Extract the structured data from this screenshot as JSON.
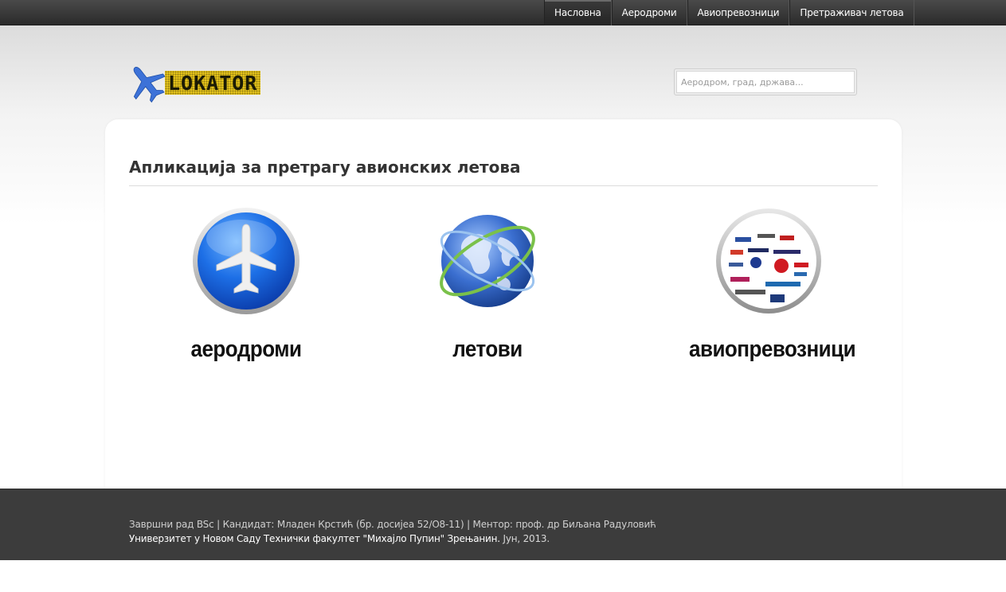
{
  "nav": {
    "items": [
      {
        "label": "Насловна",
        "active": true
      },
      {
        "label": "Аеродроми",
        "active": false
      },
      {
        "label": "Авиопревозници",
        "active": false
      },
      {
        "label": "Претраживач летова",
        "active": false
      }
    ]
  },
  "logo": {
    "text": "LOKATOR",
    "icon": "airplane-icon"
  },
  "search": {
    "placeholder": "Аеродром, град, држава..."
  },
  "main": {
    "title": "Апликација за претрагу авионских летова",
    "features": [
      {
        "label": "аеродроми",
        "icon": "airplane-circle-icon"
      },
      {
        "label": "летови",
        "icon": "globe-icon"
      },
      {
        "label": "авиопревозници",
        "icon": "airlines-logos-icon"
      }
    ]
  },
  "footer": {
    "line1": "Завршни рад BSc  |  Кандидат: Младен Крстић (бр. досијеа 52/О8-11)  |  Ментор: проф. др Биљана Радуловић",
    "line2_bold": "Универзитет у Новом Саду Технички факултет \"Михајло Пупин\" Зрењанин.",
    "line2_rest": " Јун, 2013."
  },
  "colors": {
    "topbar": "#2e2e2e",
    "footer": "#3c3c3c",
    "logo_accent": "#e3c21a",
    "plane_blue": "#3d72d8"
  }
}
